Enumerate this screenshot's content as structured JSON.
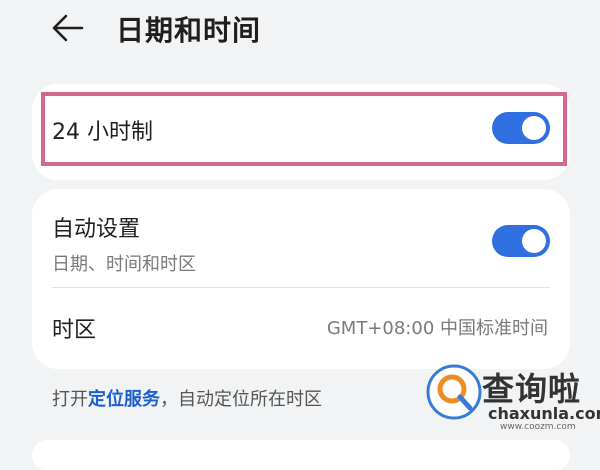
{
  "header": {
    "back_icon": "arrow-left-icon",
    "title": "日期和时间"
  },
  "settings": {
    "hour24": {
      "label": "24 小时制",
      "enabled": true
    },
    "auto": {
      "label": "自动设置",
      "sublabel": "日期、时间和时区",
      "enabled": true
    },
    "timezone": {
      "label": "时区",
      "value": "GMT+08:00 中国标准时间"
    }
  },
  "footnote": {
    "prefix": "打开",
    "link": "定位服务",
    "suffix": "，自动定位所在时区"
  },
  "watermark": {
    "name": "查询啦",
    "domain": "chaxunla.com",
    "sub": "www.coozm.com"
  },
  "colors": {
    "accent": "#2f6fe0",
    "highlight_border": "#d4688f",
    "link": "#1c5fcf",
    "background": "#f1f3f5"
  }
}
